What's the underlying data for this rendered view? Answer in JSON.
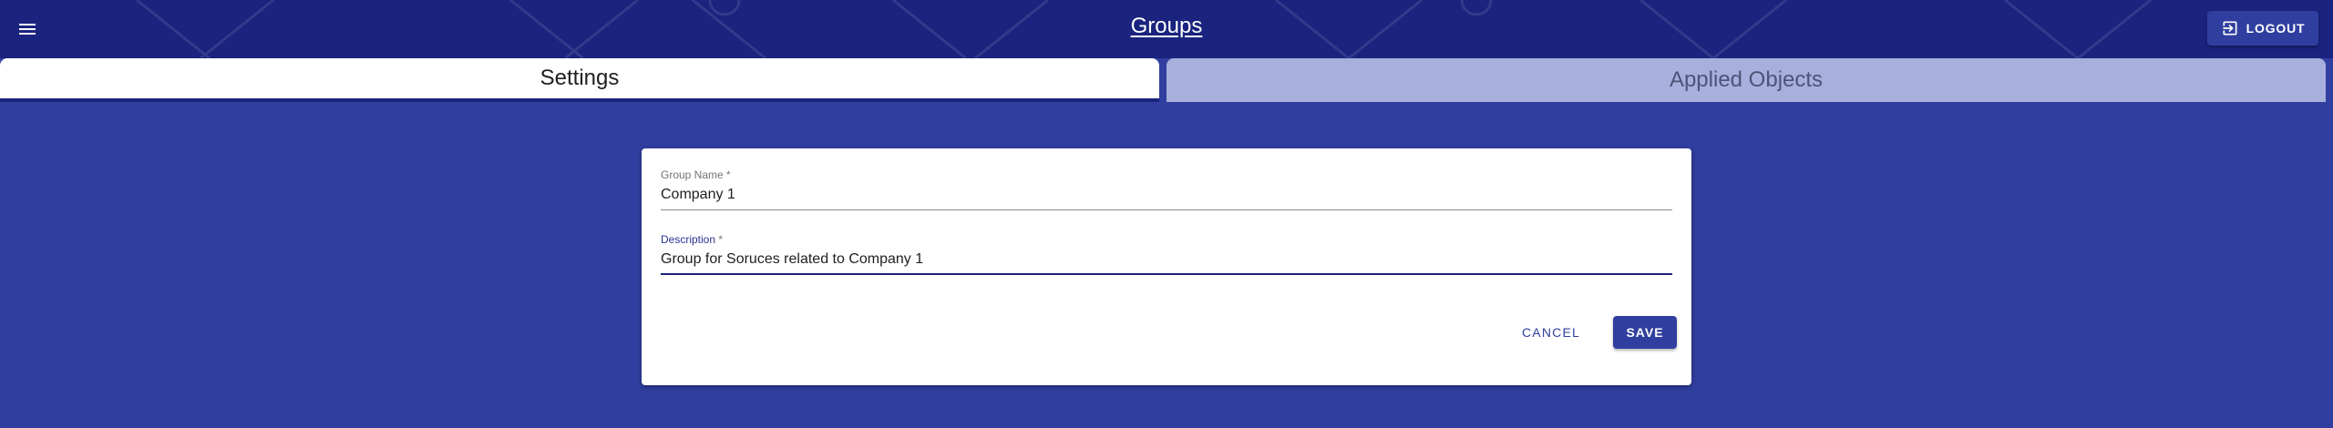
{
  "header": {
    "title": "Groups",
    "logout_label": "LOGOUT",
    "menu_icon": "menu-icon",
    "logout_icon": "logout-icon"
  },
  "tabs": [
    {
      "label": "Settings",
      "active": true
    },
    {
      "label": "Applied Objects",
      "active": false
    }
  ],
  "form": {
    "group_name": {
      "label": "Group Name",
      "required_mark": "*",
      "value": "Company 1"
    },
    "description": {
      "label": "Description",
      "required_mark": "*",
      "value": "Group for Soruces related to Company 1"
    },
    "cancel_label": "CANCEL",
    "save_label": "SAVE"
  },
  "colors": {
    "app_bar": "#1a237e",
    "background": "#303f9f",
    "accent": "#303f9f",
    "inactive_tab": "#a7b0dc"
  }
}
